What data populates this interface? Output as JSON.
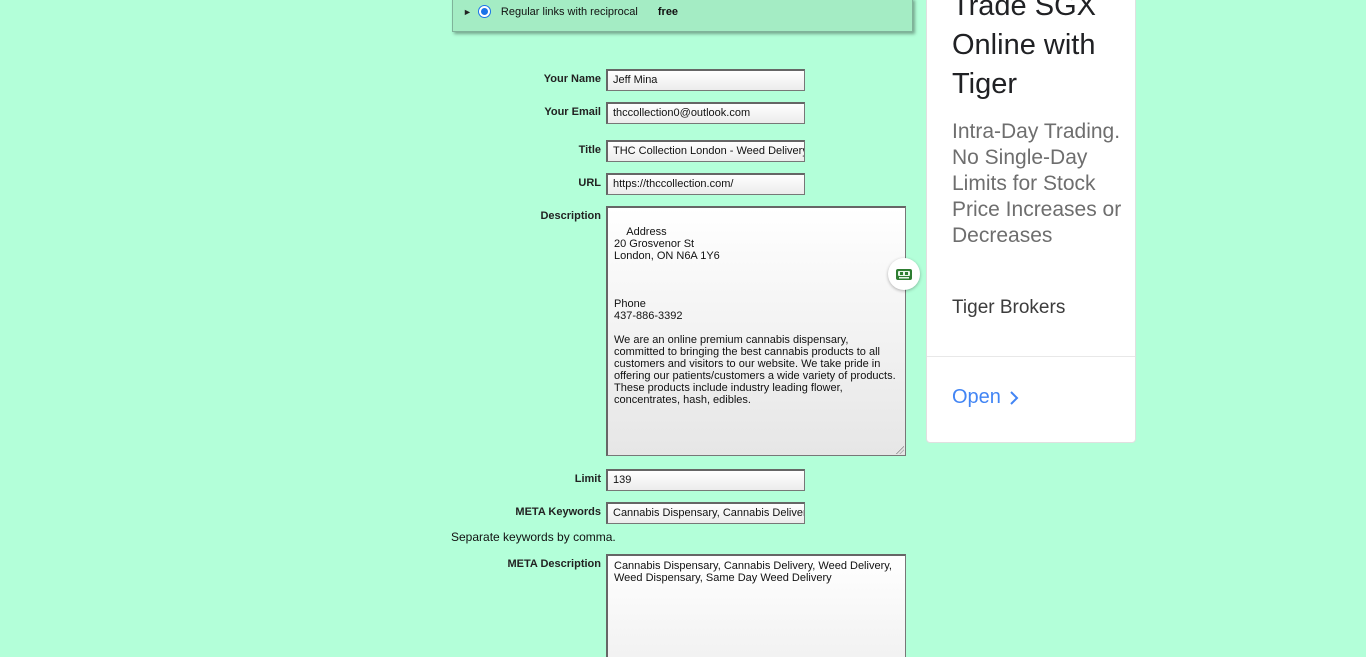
{
  "option": {
    "label": "Regular links with reciprocal",
    "price": "free"
  },
  "form": {
    "name_label": "Your Name",
    "name_value": "Jeff Mina",
    "email_label": "Your Email",
    "email_value": "thccollection0@outlook.com",
    "title_label": "Title",
    "title_value": "THC Collection London - Weed Delivery",
    "url_label": "URL",
    "url_value": "https://thccollection.com/",
    "description_label": "Description",
    "description_value": "Address\n20 Grosvenor St\nLondon, ON N6A 1Y6\n\n\n\nPhone\n437-886-3392\n\nWe are an online premium cannabis dispensary, committed to bringing the best cannabis products to all customers and visitors to our website. We take pride in offering our patients/customers a wide variety of products. These products include industry leading flower, concentrates, hash, edibles.",
    "limit_label": "Limit",
    "limit_value": "139",
    "meta_keywords_label": "META Keywords",
    "meta_keywords_value": "Cannabis Dispensary, Cannabis Delivery",
    "keywords_hint": "Separate keywords by comma.",
    "meta_description_label": "META Description",
    "meta_description_value": "Cannabis Dispensary, Cannabis Delivery, Weed Delivery, Weed Dispensary, Same Day Weed Delivery"
  },
  "ad": {
    "title": "Trade SGX Online with Tiger",
    "body": "Intra-Day Trading. No Single-Day Limits for Stock Price Increases or Decreases",
    "brand": "Tiger Brokers",
    "cta": "Open"
  },
  "icons": {
    "expand": "chevron-right-icon",
    "assistant": "robot-icon"
  },
  "colors": {
    "background": "#b3ffd9",
    "option_box": "#a4ecc4",
    "ad_cta": "#4285f4"
  }
}
